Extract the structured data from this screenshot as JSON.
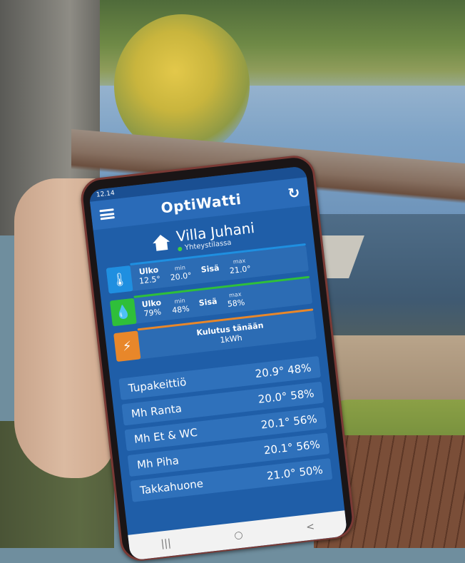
{
  "status_bar": {
    "time": "12.14",
    "right_icons": ""
  },
  "app": {
    "title": "OptiWatti",
    "refresh_icon": "refresh-icon",
    "menu_icon": "menu-icon"
  },
  "site": {
    "name": "Villa Juhani",
    "status": "Yhteystilassa",
    "status_color": "#3fcf3f"
  },
  "temperature_card": {
    "outside_label": "Ulko",
    "outside_value": "12.5°",
    "min_label": "min",
    "min_value": "20.0°",
    "inside_label": "Sisä",
    "max_label": "max",
    "max_value": "21.0°",
    "accent": "#1f8fe0"
  },
  "humidity_card": {
    "outside_label": "Ulko",
    "outside_value": "79%",
    "min_label": "min",
    "min_value": "48%",
    "inside_label": "Sisä",
    "max_label": "max",
    "max_value": "58%",
    "accent": "#2fbf3a"
  },
  "consumption_card": {
    "title": "Kulutus tänään",
    "value": "1kWh",
    "accent": "#e8872a"
  },
  "rooms": [
    {
      "name": "Tupakeittiö",
      "reading": "20.9° 48%"
    },
    {
      "name": "Mh Ranta",
      "reading": "20.0° 58%"
    },
    {
      "name": "Mh Et & WC",
      "reading": "20.1° 56%"
    },
    {
      "name": "Mh Piha",
      "reading": "20.1° 56%"
    },
    {
      "name": "Takkahuone",
      "reading": "21.0° 50%"
    }
  ],
  "nav": {
    "recent": "|||",
    "home": "○",
    "back": "<"
  }
}
